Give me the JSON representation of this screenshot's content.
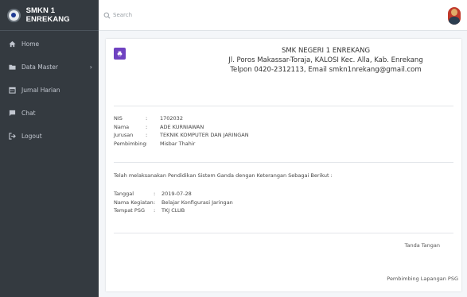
{
  "brand": {
    "title": "SMKN 1 ENREKANG"
  },
  "nav": [
    {
      "label": "Home",
      "icon": "home-icon"
    },
    {
      "label": "Data Master",
      "icon": "folder-icon",
      "has_submenu": true
    },
    {
      "label": "Jurnal Harian",
      "icon": "calendar-icon"
    },
    {
      "label": "Chat",
      "icon": "chat-icon"
    },
    {
      "label": "Logout",
      "icon": "logout-icon"
    }
  ],
  "search": {
    "placeholder": "Search"
  },
  "school": {
    "name": "SMK NEGERI 1 ENREKANG",
    "address": "Jl. Poros Makassar-Toraja, KALOSI Kec. Alla, Kab. Enrekang",
    "contact": "Telpon 0420-2312113, Email smkn1nrekang@gmail.com"
  },
  "student": {
    "nis_label": "NIS",
    "nis": "1702032",
    "nama_label": "Nama",
    "nama": "ADE KURNIAWAN",
    "jurusan_label": "Jurusan",
    "jurusan": "TEKNIK KOMPUTER DAN JARINGAN",
    "pembimbing_label": "Pembimbing",
    "pembimbing": "Misbar Thahir"
  },
  "statement": "Telah melaksanakan Pendidikan Sistem Ganda dengan Keterangan Sebagai Berikut :",
  "activity": {
    "tanggal_label": "Tanggal",
    "tanggal": "2019-07-28",
    "kegiatan_label": "Nama Kegiatan",
    "kegiatan": "Belajar Konfigurasi Jaringan",
    "tempat_label": "Tempat PSG",
    "tempat": "TKJ CLUB"
  },
  "signature": {
    "label": "Tanda Tangan",
    "role": "Pembimbing Lapangan PSG"
  },
  "sep": ":",
  "colors": {
    "sidebar": "#343a40",
    "accent": "#6f42c1",
    "background": "#f4f6f9"
  }
}
